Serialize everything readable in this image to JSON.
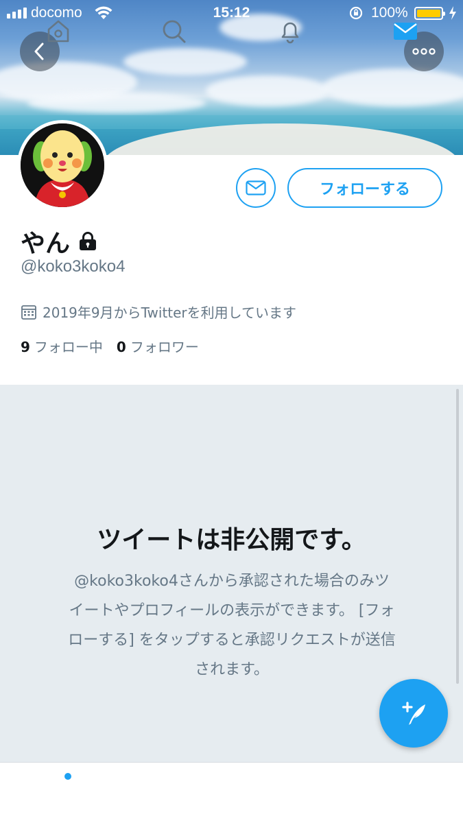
{
  "status_bar": {
    "carrier": "docomo",
    "time": "15:12",
    "battery_percent": "100%",
    "battery_color": "#ffcc00"
  },
  "header": {
    "back_icon": "chevron-left-icon",
    "more_icon": "more-horizontal-icon"
  },
  "profile": {
    "name": "やん",
    "protected_icon": "lock-icon",
    "handle": "@koko3koko4",
    "joined": "2019年9月からTwitterを利用しています",
    "following_count": "9",
    "following_label": "フォロー中",
    "followers_count": "0",
    "followers_label": "フォロワー",
    "follow_button": "フォローする",
    "accent_color": "#1da1f2"
  },
  "protected_notice": {
    "title": "ツイートは非公開です。",
    "body_line1": "@koko3koko4さんから承認された場合のみツ",
    "body_line2": "イートやプロフィールの表示ができます。 [フォ",
    "body_line3": "ローする] をタップすると承認リクエストが送信",
    "body_line4": "されます。"
  },
  "tabbar": {
    "items": [
      "home-icon",
      "search-icon",
      "bell-icon",
      "mail-icon"
    ],
    "active": "mail-icon"
  }
}
